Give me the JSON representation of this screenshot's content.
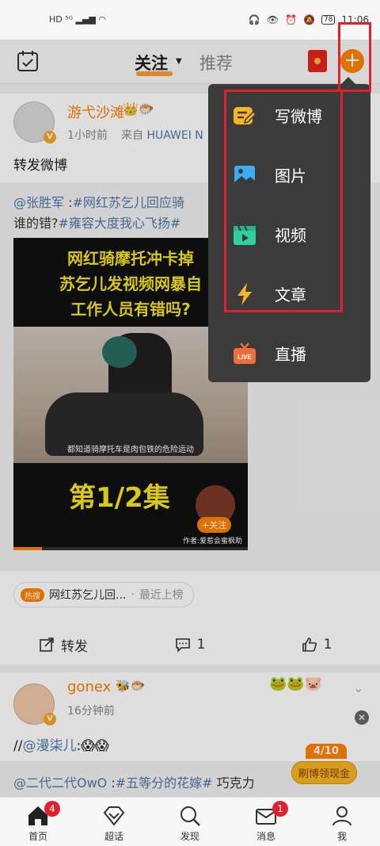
{
  "status_bar": {
    "left": "HD ⁵ᴳ ▂▄▆ ◠",
    "battery": "78",
    "time": "11:06"
  },
  "header": {
    "tab_follow": "关注",
    "tab_recommend": "推荐",
    "plus_label": "+"
  },
  "post1": {
    "author": "游弋沙滩",
    "badges": "👑🐡",
    "time": "1小时前",
    "source_prefix": "来自",
    "source": "HUAWEI N",
    "text": "转发微博",
    "repost_line1_user": "@张胜军",
    "repost_line1_sep": " :",
    "repost_line1_tag": "#网红苏乞儿回应骑",
    "repost_line2_text": "谁的错?",
    "repost_line2_tag": "#雍容大度我心飞扬#",
    "video": {
      "title_line1": "网红骑摩托冲卡掉",
      "title_line2": "苏乞儿发视频网暴自",
      "title_line3": "工作人员有错吗?",
      "subtitle": "都知道骑摩托车是肉包铁的危险运动",
      "episode": "第1/2集",
      "follow": "+关注",
      "author": "作者:爱惹会蜜枫助",
      "progress": 0.12
    },
    "hot_label": "热搜",
    "hot_text": "网红苏乞儿回...",
    "hot_sep": "·",
    "hot_status": "最近上榜",
    "actions": {
      "repost": "转发",
      "comment": "1",
      "like": "1"
    }
  },
  "post2": {
    "author": "gonex",
    "badges": "🐝🐡",
    "time": "16分钟前",
    "stickers": "🐸🐸🐷",
    "text_prefix": "//",
    "text_mention": "@漫柒儿",
    "text_suffix": ":😱😱",
    "repost_user": "@二代二代OwO",
    "repost_sep": " :",
    "repost_tag": "#五等分的花嫁#",
    "repost_suffix": " 巧克力"
  },
  "reward": {
    "count": "4/10",
    "label": "刷博领现金"
  },
  "menu": {
    "items": [
      {
        "label": "写微博",
        "icon": "write-icon",
        "color": "#f6b623"
      },
      {
        "label": "图片",
        "icon": "image-icon",
        "color": "#3aaef0"
      },
      {
        "label": "视频",
        "icon": "video-icon",
        "color": "#2fd0a0"
      },
      {
        "label": "文章",
        "icon": "lightning-icon",
        "color": "#f6b623"
      },
      {
        "label": "直播",
        "icon": "live-icon",
        "color": "#f26b3a"
      }
    ]
  },
  "nav": {
    "items": [
      {
        "label": "首页",
        "badge": "4"
      },
      {
        "label": "超话"
      },
      {
        "label": "发现"
      },
      {
        "label": "消息",
        "badge": "1"
      },
      {
        "label": "我"
      }
    ]
  },
  "colors": {
    "accent": "#ff8200",
    "highlight": "#e0202e",
    "link": "#4e79a6"
  }
}
